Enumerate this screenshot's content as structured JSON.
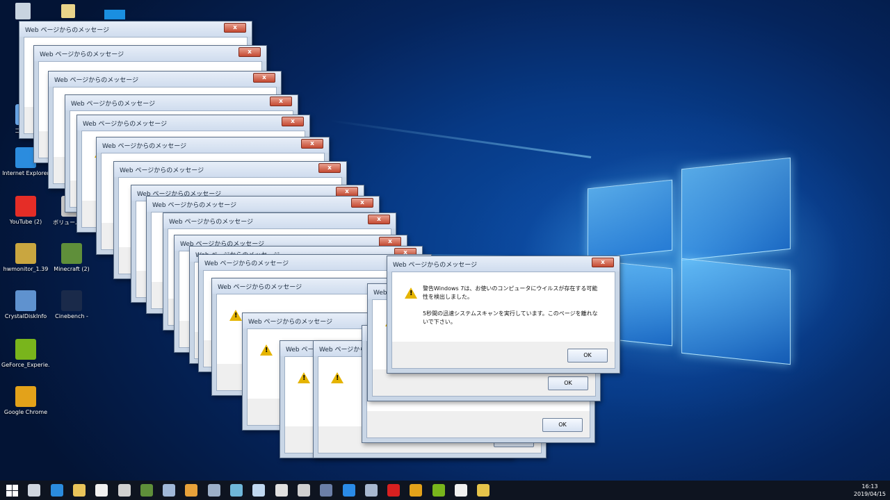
{
  "desktop_icons": [
    {
      "label": "コントロ",
      "icon": "control-panel-icon",
      "color": "#6aa7e8"
    },
    {
      "label": "Internet Explorer",
      "icon": "ie-icon",
      "color": "#2b8cde"
    },
    {
      "label": "YouTube (2)",
      "icon": "youtube-icon",
      "color": "#e52d27"
    },
    {
      "label": "ボリューム (1)",
      "icon": "volume-icon",
      "color": "#c9c9c9"
    },
    {
      "label": "hwmonitor_1.39",
      "icon": "hwmonitor-icon",
      "color": "#c9a640"
    },
    {
      "label": "Minecraft (2)",
      "icon": "minecraft-icon",
      "color": "#5f8f3a"
    },
    {
      "label": "CrystalDiskInfo",
      "icon": "crystaldiskinfo-icon",
      "color": "#5f92cf"
    },
    {
      "label": "Cinebench -",
      "icon": "cinebench-icon",
      "color": "#1a2a4a"
    },
    {
      "label": "GeForce_Experie...",
      "icon": "geforce-icon",
      "color": "#79b51c"
    },
    {
      "label": "Google Chrome",
      "icon": "chrome-icon",
      "color": "#e3a21a"
    }
  ],
  "dialog": {
    "title": "Web ページからのメッセージ",
    "close_label": "x",
    "message_line1": "警告Windows 7は、お使いのコンピュータにウイルスが存在する可能",
    "message_line2": "性を検出しました。",
    "message_line3": "5秒間の迅速システムスキャンを実行しています。このページを離れな",
    "message_line4": "いで下さい。",
    "ok_label": "OK"
  },
  "taskbar": {
    "apps": [
      "start-icon",
      "task-view-icon",
      "ie-icon",
      "file-explorer-icon",
      "jp-app-icon",
      "film-icon",
      "minecraft-icon",
      "game-icon",
      "media-player-icon",
      "steam-icon",
      "app-icon",
      "notepad-icon",
      "calculator-icon",
      "mic-icon",
      "cinebench-icon",
      "blue-app-icon",
      "chart-icon",
      "flash-icon",
      "chrome-icon",
      "nvidia-icon",
      "photos-icon",
      "star-app-icon"
    ],
    "time": "16:13",
    "date": "2019/04/15"
  }
}
